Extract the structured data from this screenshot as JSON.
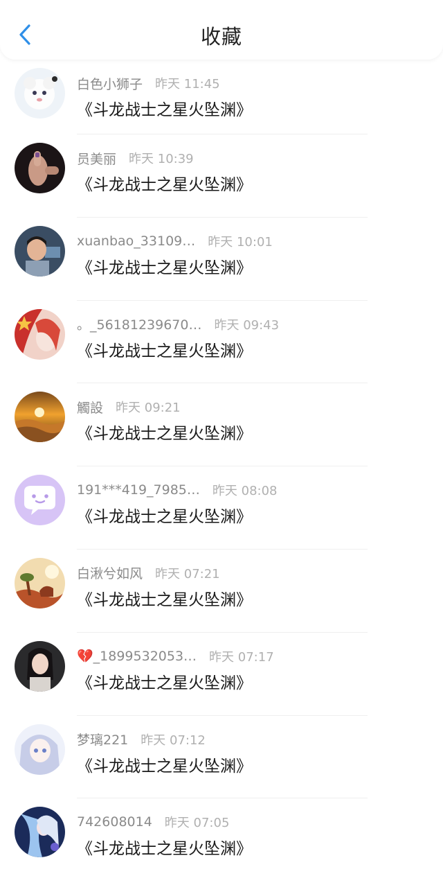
{
  "header": {
    "title": "收藏"
  },
  "items": [
    {
      "name": "白色小狮子",
      "time": "昨天 11:45",
      "text": "《斗龙战士之星火坠渊》"
    },
    {
      "name": "员美丽",
      "time": "昨天 10:39",
      "text": "《斗龙战士之星火坠渊》"
    },
    {
      "name": "xuanbao_33109…",
      "time": "昨天 10:01",
      "text": "《斗龙战士之星火坠渊》"
    },
    {
      "name": "。_56181239670…",
      "time": "昨天 09:43",
      "text": "《斗龙战士之星火坠渊》"
    },
    {
      "name": "觸設",
      "time": "昨天 09:21",
      "text": "《斗龙战士之星火坠渊》"
    },
    {
      "name": "191***419_7985…",
      "time": "昨天 08:08",
      "text": "《斗龙战士之星火坠渊》"
    },
    {
      "name": "白湫兮如风",
      "time": "昨天 07:21",
      "text": "《斗龙战士之星火坠渊》"
    },
    {
      "name": "💔_1899532053…",
      "time": "昨天 07:17",
      "text": "《斗龙战士之星火坠渊》"
    },
    {
      "name": "梦璃221",
      "time": "昨天 07:12",
      "text": "《斗龙战士之星火坠渊》"
    },
    {
      "name": "742608014",
      "time": "昨天 07:05",
      "text": "《斗龙战士之星火坠渊》"
    }
  ],
  "colors": {
    "accent": "#2f8fe8",
    "name": "#8a8a8a",
    "time": "#b0b0b0"
  }
}
